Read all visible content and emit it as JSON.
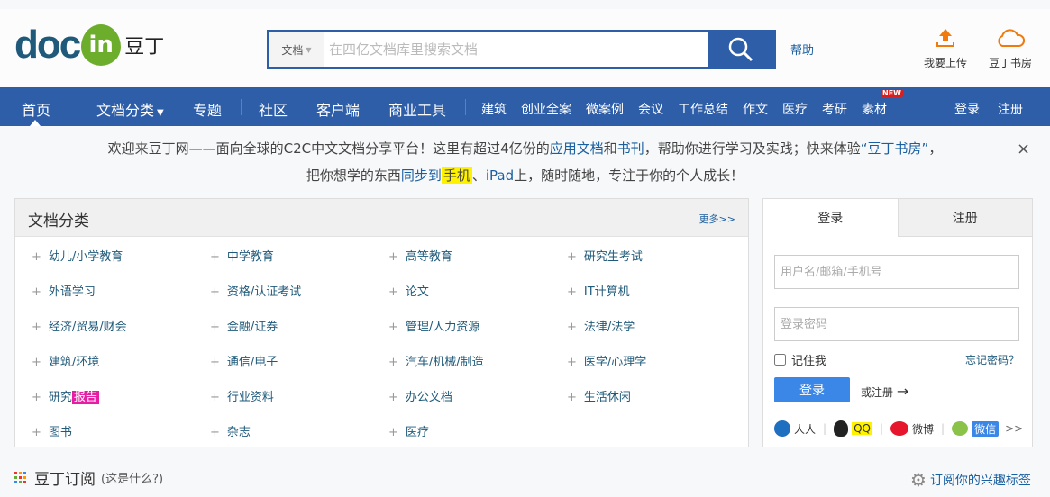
{
  "header": {
    "logo_text": "docin",
    "logo_in": "in",
    "logo_cn": "豆丁",
    "search_type": "文档",
    "search_placeholder": "在四亿文档库里搜索文档",
    "help": "帮助",
    "upload": "我要上传",
    "bookstore": "豆丁书房"
  },
  "nav": {
    "items": [
      "首页",
      "文档分类",
      "专题",
      "社区",
      "客户端",
      "商业工具"
    ],
    "small_items": [
      "建筑",
      "创业全案",
      "微案例",
      "会议",
      "工作总结",
      "作文",
      "医疗",
      "考研",
      "素材"
    ],
    "new_badge": "NEW",
    "login": "登录",
    "register": "注册"
  },
  "notice": {
    "line1_a": "欢迎来豆丁网——面向全球的C2C中文文档分享平台！这里有超过4亿份的",
    "link1": "应用文档",
    "and": "和",
    "link2": "书刊",
    "line1_b": "，帮助你进行学习及实践；快来体验",
    "link3": "“豆丁书房”",
    "line1_c": "，",
    "line2_a": "把你想学的东西",
    "link4": "同步到",
    "hl": "手机",
    "sep": "、",
    "link5": "iPad",
    "line2_b": "上，随时随地，专注于你的个人成长！",
    "close": "×"
  },
  "category": {
    "title": "文档分类",
    "more": "更多>>",
    "items": [
      [
        "幼儿/小学教育",
        "中学教育",
        "高等教育",
        "研究生考试"
      ],
      [
        "外语学习",
        "资格/认证考试",
        "论文",
        "IT计算机"
      ],
      [
        "经济/贸易/财会",
        "金融/证券",
        "管理/人力资源",
        "法律/法学"
      ],
      [
        "建筑/环境",
        "通信/电子",
        "汽车/机械/制造",
        "医学/心理学"
      ],
      [
        "研究",
        "行业资料",
        "办公文档",
        "生活休闲"
      ],
      [
        "图书",
        "杂志",
        "医疗"
      ]
    ],
    "report_badge": "报告"
  },
  "login": {
    "tab_login": "登录",
    "tab_register": "注册",
    "username_placeholder": "用户名/邮箱/手机号",
    "password_placeholder": "登录密码",
    "remember": "记住我",
    "forgot": "忘记密码？",
    "submit": "登录",
    "or_register": "或注册",
    "social": [
      "人人",
      "QQ",
      "微博",
      "微信"
    ],
    "more": ">>"
  },
  "subscribe": {
    "title": "豆丁订阅",
    "what": "(这是什么?)",
    "tags": "订阅你的兴趣标签"
  }
}
